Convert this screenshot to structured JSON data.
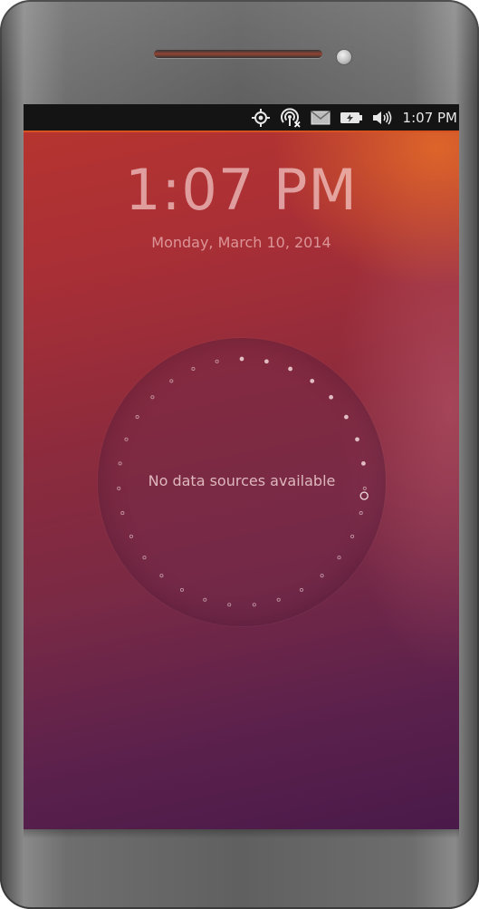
{
  "statusbar": {
    "time": "1:07 PM",
    "icons": [
      "location-icon",
      "network-disconnected-icon",
      "messages-icon",
      "battery-icon",
      "volume-icon"
    ]
  },
  "lockscreen": {
    "time": "1:07 PM",
    "date": "Monday, March 10, 2014"
  },
  "infographic": {
    "message": "No data sources available"
  },
  "colors": {
    "statusbar_accent": "#d7521f",
    "wallpaper_top": "#b8352f",
    "wallpaper_bottom": "#4a1a4a"
  }
}
